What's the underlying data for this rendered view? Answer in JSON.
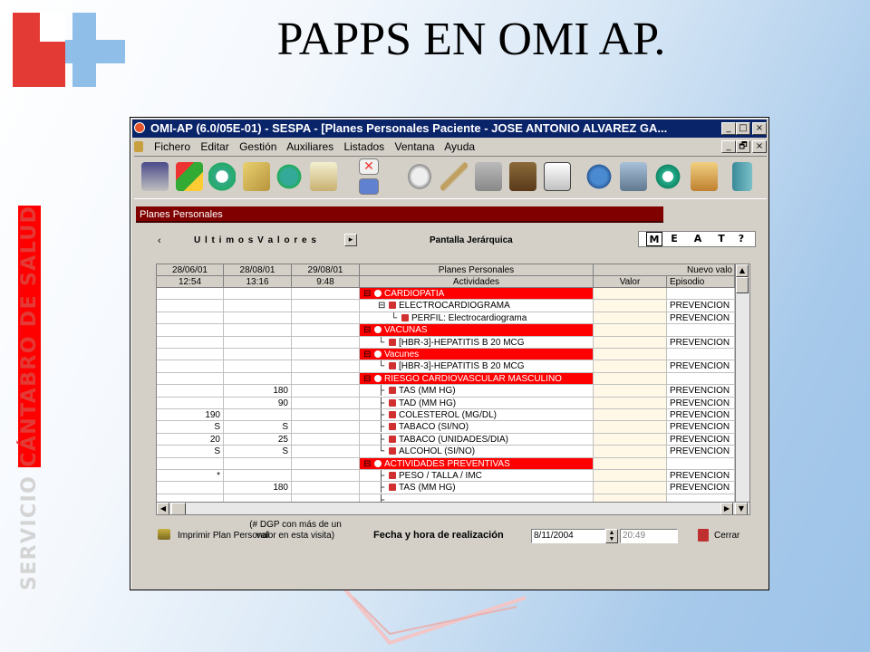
{
  "slide": {
    "title": "PAPPS EN OMI AP.",
    "vertical_text_grey": "SERVICIO ",
    "vertical_text_red": "CÁNTABRO DE SALUD"
  },
  "window": {
    "title": "OMI-AP (6.0/05E-01) - SESPA - [Planes Personales Paciente - JOSE ANTONIO ALVAREZ GA...",
    "controls": [
      "_",
      "□",
      "×"
    ],
    "child_controls": [
      "_",
      "🗗",
      "×"
    ]
  },
  "menu": [
    "Fichero",
    "Editar",
    "Gestión",
    "Auxiliares",
    "Listados",
    "Ventana",
    "Ayuda"
  ],
  "toolbar_icons": [
    "user-icon",
    "color-blocks-icon",
    "clock-icon",
    "map-icon",
    "globe-icon",
    "notes-icon",
    "close-red-icon",
    "window-icon",
    "pill-icon",
    "syringe-icon",
    "thumb-icon",
    "cabinet-icon",
    "checklist-icon",
    "world-icon",
    "folder-icon",
    "health-icon",
    "house-icon",
    "book-icon"
  ],
  "banner": "Planes Personales",
  "nav": {
    "prev_label": "‹",
    "last_values": "U l t i m o s  V a l o r e s",
    "next_label": "▸",
    "view_label": "Pantalla Jerárquica",
    "tabs": [
      "M",
      "E",
      "A",
      "T",
      "?"
    ]
  },
  "grid": {
    "date_headers": [
      "28/06/01",
      "28/08/01",
      "29/08/01"
    ],
    "time_headers": [
      "12:54",
      "13:16",
      "9:48"
    ],
    "plans_header": "Planes Personales",
    "activities_header": "Actividades",
    "new_header": "Nuevo valo",
    "valor_header": "Valor",
    "episodio_header": "Episodio",
    "rows": [
      {
        "c1": "",
        "c2": "",
        "c3": "",
        "tree": "⊟",
        "label": "CARDIOPATIA",
        "red": true,
        "episodio": ""
      },
      {
        "c1": "",
        "c2": "",
        "c3": "",
        "tree": "⊟",
        "label": "ELECTROCARDIOGRAMA",
        "red": false,
        "episodio": "PREVENCION"
      },
      {
        "c1": "",
        "c2": "",
        "c3": "",
        "tree": "└",
        "label": "PERFIL: Electrocardiograma",
        "red": false,
        "episodio": "PREVENCION"
      },
      {
        "c1": "",
        "c2": "",
        "c3": "",
        "tree": "⊟",
        "label": "VACUNAS",
        "red": true,
        "episodio": ""
      },
      {
        "c1": "",
        "c2": "",
        "c3": "",
        "tree": "└",
        "label": "[HBR-3]-HEPATITIS B 20 MCG",
        "red": false,
        "episodio": "PREVENCION"
      },
      {
        "c1": "",
        "c2": "",
        "c3": "",
        "tree": "⊟",
        "label": "Vacunes",
        "red": true,
        "episodio": ""
      },
      {
        "c1": "",
        "c2": "",
        "c3": "",
        "tree": "└",
        "label": "[HBR-3]-HEPATITIS B 20 MCG",
        "red": false,
        "episodio": "PREVENCION"
      },
      {
        "c1": "",
        "c2": "",
        "c3": "",
        "tree": "⊟",
        "label": "RIESGO CARDIOVASCULAR MASCULINO",
        "red": true,
        "episodio": ""
      },
      {
        "c1": "",
        "c2": "180",
        "c3": "",
        "tree": "├",
        "label": "TAS (MM HG)",
        "red": false,
        "episodio": "PREVENCION"
      },
      {
        "c1": "",
        "c2": "90",
        "c3": "",
        "tree": "├",
        "label": "TAD (MM HG)",
        "red": false,
        "episodio": "PREVENCION"
      },
      {
        "c1": "190",
        "c2": "",
        "c3": "",
        "tree": "├",
        "label": "COLESTEROL (MG/DL)",
        "red": false,
        "episodio": "PREVENCION"
      },
      {
        "c1": "S",
        "c2": "S",
        "c3": "",
        "tree": "├",
        "label": "TABACO (SI/NO)",
        "red": false,
        "episodio": "PREVENCION"
      },
      {
        "c1": "20",
        "c2": "25",
        "c3": "",
        "tree": "├",
        "label": "TABACO (UNIDADES/DIA)",
        "red": false,
        "episodio": "PREVENCION"
      },
      {
        "c1": "S",
        "c2": "S",
        "c3": "",
        "tree": "└",
        "label": "ALCOHOL (SI/NO)",
        "red": false,
        "episodio": "PREVENCION"
      },
      {
        "c1": "",
        "c2": "",
        "c3": "",
        "tree": "⊟",
        "label": "ACTIVIDADES PREVENTIVAS",
        "red": true,
        "episodio": ""
      },
      {
        "c1": "*",
        "c2": "",
        "c3": "",
        "tree": "├",
        "label": "PESO / TALLA / IMC",
        "red": false,
        "episodio": "PREVENCION"
      },
      {
        "c1": "",
        "c2": "180",
        "c3": "",
        "tree": "├",
        "label": "TAS (MM HG)",
        "red": false,
        "episodio": "PREVENCION"
      },
      {
        "c1": "",
        "c2": "",
        "c3": "",
        "tree": "├",
        "label": "",
        "red": false,
        "episodio": ""
      }
    ]
  },
  "footer": {
    "note_line1": "(# DGP con más de un",
    "note_line2": "valor en esta visita)",
    "print_label": "Imprimir Plan Personal",
    "date_label": "Fecha y hora de realización",
    "date_value": "8/11/2004",
    "time_value": "20:49",
    "close_label": "Cerrar"
  },
  "colors": {
    "title_bar": "#0a246a",
    "banner": "#800000",
    "plan_row": "#ff0000"
  }
}
